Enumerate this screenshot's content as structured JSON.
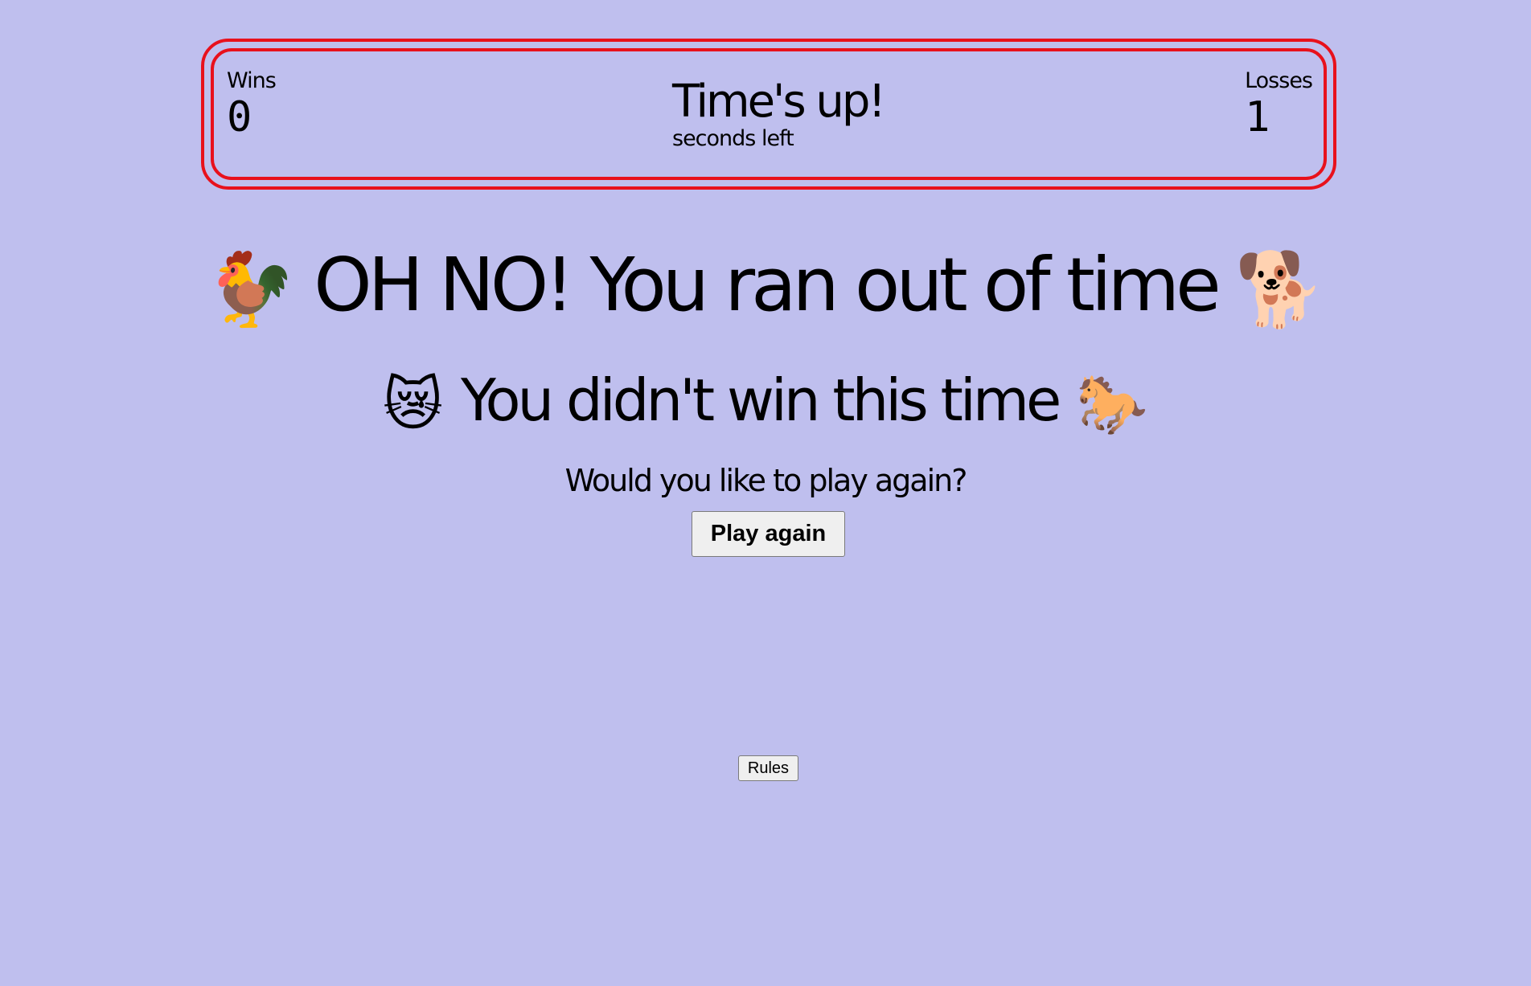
{
  "scoreboard": {
    "wins_label": "Wins",
    "wins_value": "0",
    "timer_status": "Time's up!",
    "timer_caption": "seconds left",
    "losses_label": "Losses",
    "losses_value": "1"
  },
  "headline": {
    "left_emoji": "🐓",
    "text": "OH NO! You ran out of time",
    "right_emoji": "🐕"
  },
  "subhead": {
    "left_emoji": "😿",
    "text": "You didn't win this time",
    "right_emoji": "🐎"
  },
  "prompt": "Would you like to play again?",
  "play_again_label": "Play again",
  "rules_label": "Rules",
  "colors": {
    "background": "#bfbfee",
    "scoreboard_border": "#e8111c",
    "button_bg": "#efefef"
  }
}
